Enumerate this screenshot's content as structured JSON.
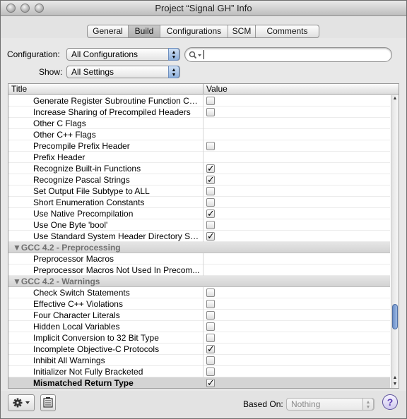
{
  "window": {
    "title": "Project “Signal GH” Info"
  },
  "tabs": [
    {
      "label": "General"
    },
    {
      "label": "Build"
    },
    {
      "label": "Configurations"
    },
    {
      "label": "SCM"
    },
    {
      "label": "Comments"
    }
  ],
  "active_tab": "Build",
  "configuration": {
    "label": "Configuration:",
    "value": "All Configurations"
  },
  "show": {
    "label": "Show:",
    "value": "All Settings"
  },
  "search": {
    "placeholder": "",
    "value": ""
  },
  "table": {
    "col_title": "Title",
    "col_value": "Value",
    "rows": [
      {
        "name": "Generate Register Subroutine Function Calls",
        "checkbox": true,
        "checked": false
      },
      {
        "name": "Increase Sharing of Precompiled Headers",
        "checkbox": true,
        "checked": false
      },
      {
        "name": "Other C Flags",
        "checkbox": false
      },
      {
        "name": "Other C++ Flags",
        "checkbox": false
      },
      {
        "name": "Precompile Prefix Header",
        "checkbox": true,
        "checked": false
      },
      {
        "name": "Prefix Header",
        "checkbox": false
      },
      {
        "name": "Recognize Built-in Functions",
        "checkbox": true,
        "checked": true
      },
      {
        "name": "Recognize Pascal Strings",
        "checkbox": true,
        "checked": true
      },
      {
        "name": "Set Output File Subtype to ALL",
        "checkbox": true,
        "checked": false
      },
      {
        "name": "Short Enumeration Constants",
        "checkbox": true,
        "checked": false
      },
      {
        "name": "Use Native Precompilation",
        "checkbox": true,
        "checked": true
      },
      {
        "name": "Use One Byte 'bool'",
        "checkbox": true,
        "checked": false
      },
      {
        "name": "Use Standard System Header Directory Se...",
        "checkbox": true,
        "checked": true
      },
      {
        "group": "GCC 4.2 - Preprocessing"
      },
      {
        "name": "Preprocessor Macros",
        "checkbox": false
      },
      {
        "name": "Preprocessor Macros Not Used In Precom...",
        "checkbox": false
      },
      {
        "group": "GCC 4.2 - Warnings"
      },
      {
        "name": "Check Switch Statements",
        "checkbox": true,
        "checked": false
      },
      {
        "name": "Effective C++ Violations",
        "checkbox": true,
        "checked": false
      },
      {
        "name": "Four Character Literals",
        "checkbox": true,
        "checked": false
      },
      {
        "name": "Hidden Local Variables",
        "checkbox": true,
        "checked": false
      },
      {
        "name": "Implicit Conversion to 32 Bit Type",
        "checkbox": true,
        "checked": false
      },
      {
        "name": "Incomplete Objective-C Protocols",
        "checkbox": true,
        "checked": true
      },
      {
        "name": "Inhibit All Warnings",
        "checkbox": true,
        "checked": false
      },
      {
        "name": "Initializer Not Fully Bracketed",
        "checkbox": true,
        "checked": false
      },
      {
        "name": "Mismatched Return Type",
        "checkbox": true,
        "checked": true,
        "selected": true
      }
    ]
  },
  "icons": {
    "gear": "gear-icon",
    "disclosure": "disclosure-triangle-icon",
    "search": "search-icon",
    "checkmark": "✓",
    "info": "info-list-icon"
  },
  "based_on": {
    "label": "Based On:",
    "value": "Nothing"
  },
  "help": {
    "label": "?"
  },
  "colors": {
    "help": "#5d3fb4",
    "thumb": "#6c8fc7"
  }
}
